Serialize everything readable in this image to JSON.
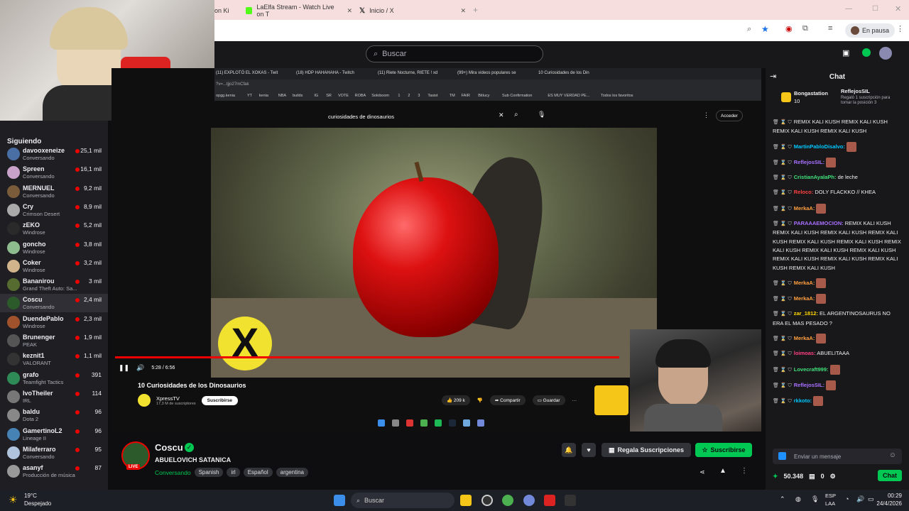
{
  "browser": {
    "tabs": [
      {
        "label": "on Ki",
        "icon": "tab-icon"
      },
      {
        "label": "LaElfa Stream - Watch Live on T",
        "icon": "kick-icon"
      },
      {
        "label": "Inicio / X",
        "icon": "x-icon"
      }
    ],
    "profile_label": "En pausa"
  },
  "twitch_header": {
    "search_placeholder": "Buscar"
  },
  "sidebar": {
    "heading": "Siguiendo",
    "channels": [
      {
        "name": "davooxeneize",
        "game": "Conversando",
        "viewers": "25,1 mil"
      },
      {
        "name": "Spreen",
        "game": "Conversando",
        "viewers": "16,1 mil"
      },
      {
        "name": "MERNUEL",
        "game": "Conversando",
        "viewers": "9,2 mil"
      },
      {
        "name": "Cry",
        "game": "Crimson Desert",
        "viewers": "8,9 mil"
      },
      {
        "name": "zEKO",
        "game": "Windrose",
        "viewers": "5,2 mil"
      },
      {
        "name": "goncho",
        "game": "Windrose",
        "viewers": "3,8 mil"
      },
      {
        "name": "Coker",
        "game": "Windrose",
        "viewers": "3,2 mil"
      },
      {
        "name": "Bananirou",
        "game": "Grand Theft Auto: Sa...",
        "viewers": "3 mil"
      },
      {
        "name": "Coscu",
        "game": "Conversando",
        "viewers": "2,4 mil"
      },
      {
        "name": "DuendePablo",
        "game": "Windrose",
        "viewers": "2,3 mil"
      },
      {
        "name": "Brunenger",
        "game": "PEAK",
        "viewers": "1,9 mil"
      },
      {
        "name": "keznit1",
        "game": "VALORANT",
        "viewers": "1,1 mil"
      },
      {
        "name": "grafo",
        "game": "Teamfight Tactics",
        "viewers": "391"
      },
      {
        "name": "IvoTheiler",
        "game": "IRL",
        "viewers": "114"
      },
      {
        "name": "baldu",
        "game": "Dota 2",
        "viewers": "96"
      },
      {
        "name": "GamertinoL2",
        "game": "Lineage II",
        "viewers": "96"
      },
      {
        "name": "Milaferraro",
        "game": "Conversando",
        "viewers": "95"
      },
      {
        "name": "asanyf",
        "game": "Producción de música",
        "viewers": "87"
      }
    ]
  },
  "inner_browser": {
    "tabs": [
      "(11) EXPLOTÓ EL XOKAS - Twit",
      "(18) HDP HAHAHAHA - Twitch",
      "(11) Riete Nocturne, RIETE ! xd",
      "(99+) Mira videos populares se",
      "10 Curiosidades de los Din"
    ],
    "url": "?v=...tjjo27mCfak",
    "bookmarks": [
      "opgg.kenia",
      "YT",
      "kenia",
      "NBA",
      "builds",
      "IG",
      "SR",
      "VOTE",
      "ROBA",
      "Soloboom",
      "1",
      "2",
      "3",
      "Tasist",
      "TM",
      "FAIR",
      "Bitlucy",
      "Sub Confirmation",
      "ES MUY VERDAD PE...",
      "Todos los favoritos"
    ],
    "youtube_search": "curiosidades de dinosaurios",
    "youtube_signin": "Acceder",
    "video_time": "5:28 / 6:56",
    "video_title": "10 Curiosidades de los Dinosaurios",
    "channel_name": "XpressTV",
    "channel_subs": "17,3 M de suscriptores",
    "subscribe_label": "Suscribirse",
    "likes": "209 k",
    "share_label": "Compartir",
    "save_label": "Guardar"
  },
  "stream_info": {
    "channel": "Coscu",
    "live_label": "LIVE",
    "title": "ABUELOVICH SATANICA",
    "category": "Conversando",
    "tags": [
      "Spanish",
      "irl",
      "Español",
      "argentina"
    ],
    "gift_label": "Regala Suscripciones",
    "subscribe_label": "Suscribirse"
  },
  "chat": {
    "title": "Chat",
    "pinned": {
      "user": "Bongastation",
      "count": "10",
      "gifter": "ReflejosSIL",
      "text": "Regaló 1 suscripción para tomar la posición 3"
    },
    "messages": [
      {
        "user": "",
        "text": "REMIX KALI KUSH REMIX KALI KUSH REMIX KALI KUSH REMIX KALI KUSH",
        "color": "#efeff1"
      },
      {
        "user": "MartinPabloDisalvo:",
        "text": "",
        "color": "#00c8ff"
      },
      {
        "user": "ReflejosSIL:",
        "text": "",
        "color": "#a970ff"
      },
      {
        "user": "CristianAyalaPh:",
        "text": "de leche",
        "color": "#3fe07a"
      },
      {
        "user": "Reloco:",
        "text": "DOLY FLACKKO // KHEA",
        "color": "#ff4040"
      },
      {
        "user": "MerkaA:",
        "text": "",
        "color": "#ff9f3f"
      },
      {
        "user": "PARAAAEMOCION:",
        "text": "REMIX KALI KUSH REMIX KALI KUSH REMIX KALI KUSH REMIX KALI KUSH REMIX KALI KUSH REMIX KALI KUSH REMIX KALI KUSH REMIX KALI KUSH REMIX KALI KUSH REMIX KALI KUSH REMIX KALI KUSH REMIX KALI KUSH REMIX KALI KUSH",
        "color": "#a970ff"
      },
      {
        "user": "MerkaA:",
        "text": "",
        "color": "#ff9f3f"
      },
      {
        "user": "MerkaA:",
        "text": "",
        "color": "#ff9f3f"
      },
      {
        "user": "zar_1812:",
        "text": "EL ARGENTINOSAURUS NO ERA EL MAS PESADO ?",
        "color": "#ffd700"
      },
      {
        "user": "MerkaA:",
        "text": "",
        "color": "#ff9f3f"
      },
      {
        "user": "loimoas:",
        "text": "ABUELITAAA",
        "color": "#ff4080"
      },
      {
        "user": "Lovecraft999:",
        "text": "",
        "color": "#3fe07a"
      },
      {
        "user": "ReflejosSIL:",
        "text": "",
        "color": "#a970ff"
      },
      {
        "user": "rkkoto:",
        "text": "",
        "color": "#00c8ff"
      }
    ],
    "input_placeholder": "Enviar un mensaje",
    "points": "50.348",
    "viewers": "0",
    "chat_button": "Chat"
  },
  "taskbar": {
    "weather_temp": "19°C",
    "weather_desc": "Despejado",
    "search_label": "Buscar",
    "lang_top": "ESP",
    "lang_bottom": "LAA",
    "time": "00:29",
    "date": "24/4/2026"
  }
}
